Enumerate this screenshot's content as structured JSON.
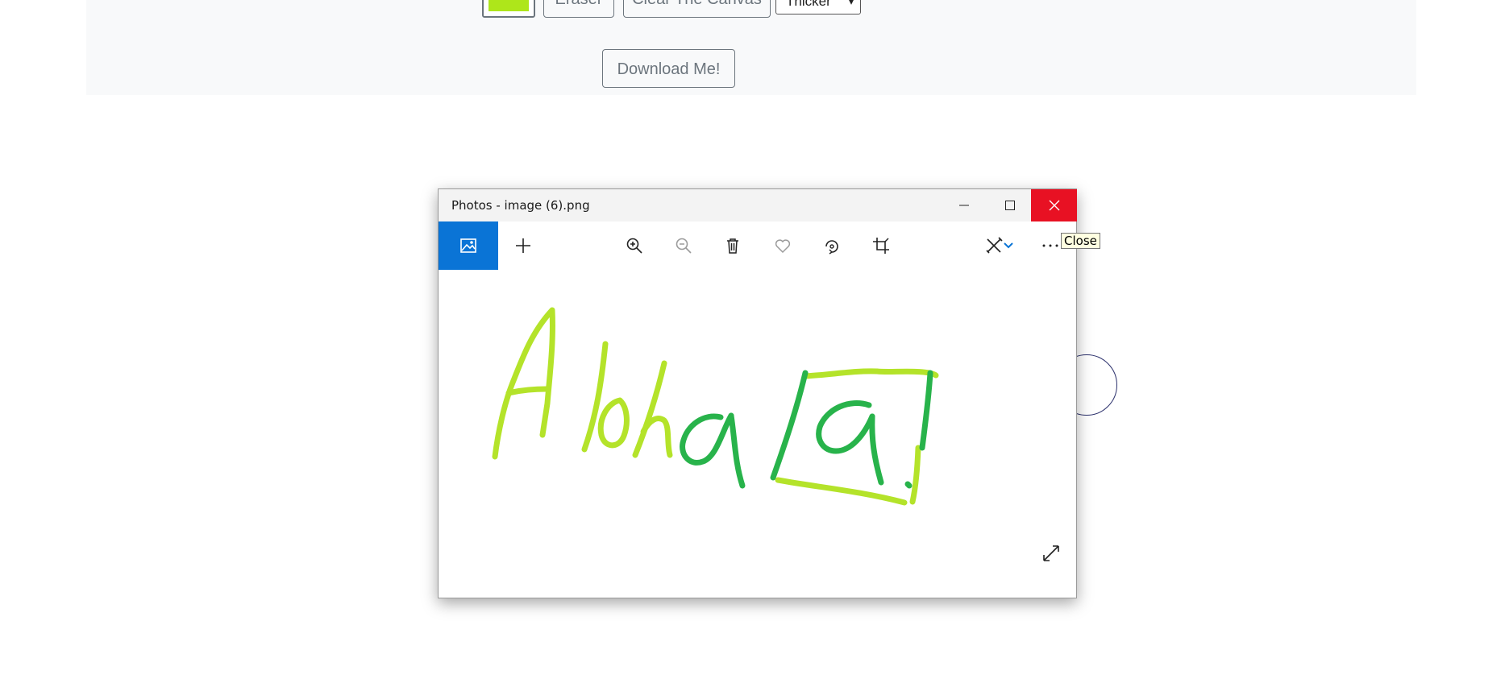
{
  "page_toolbar": {
    "eraser_label": "Eraser",
    "clear_label": "Clear The Canvas",
    "thickness_selected": "Thicker",
    "download_label": "Download Me!",
    "pen_color": "#aee61a"
  },
  "photos_window": {
    "title": "Photos - image (6).png",
    "tooltip": "Close",
    "close_color": "#e81123",
    "accent_color": "#0a74d6",
    "drawing_colors": {
      "light_green": "#b4e32a",
      "dark_green": "#28b34b"
    }
  }
}
